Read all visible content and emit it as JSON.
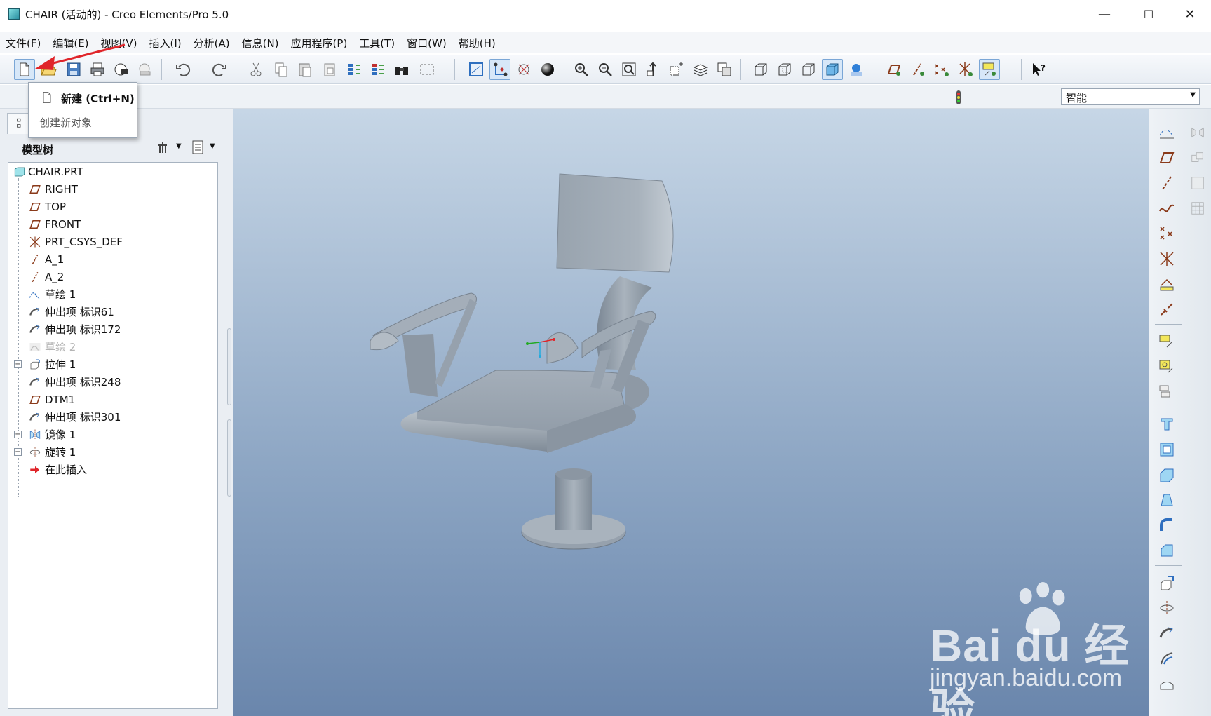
{
  "window": {
    "title": "CHAIR (活动的) - Creo Elements/Pro 5.0",
    "minimize": "—",
    "maximize": "☐",
    "close": "✕"
  },
  "menu": [
    "文件(F)",
    "编辑(E)",
    "视图(V)",
    "插入(I)",
    "分析(A)",
    "信息(N)",
    "应用程序(P)",
    "工具(T)",
    "窗口(W)",
    "帮助(H)"
  ],
  "tooltip": {
    "title": "新建 (Ctrl+N)",
    "description": "创建新对象"
  },
  "filter": {
    "value": "智能"
  },
  "panel": {
    "title": "模型树"
  },
  "tree": [
    {
      "label": "CHAIR.PRT",
      "icon": "part-icon",
      "root": true
    },
    {
      "label": "RIGHT",
      "icon": "datum-plane-icon"
    },
    {
      "label": "TOP",
      "icon": "datum-plane-icon"
    },
    {
      "label": "FRONT",
      "icon": "datum-plane-icon"
    },
    {
      "label": "PRT_CSYS_DEF",
      "icon": "csys-icon"
    },
    {
      "label": "A_1",
      "icon": "axis-icon"
    },
    {
      "label": "A_2",
      "icon": "axis-icon"
    },
    {
      "label": "草绘 1",
      "icon": "sketch-icon"
    },
    {
      "label": "伸出项 标识61",
      "icon": "sweep-icon"
    },
    {
      "label": "伸出项 标识172",
      "icon": "sweep-icon"
    },
    {
      "label": "草绘 2",
      "icon": "sketch-icon",
      "dim": true
    },
    {
      "label": "拉伸 1",
      "icon": "extrude-icon",
      "expandable": true
    },
    {
      "label": "伸出项 标识248",
      "icon": "sweep-icon"
    },
    {
      "label": "DTM1",
      "icon": "datum-plane-icon"
    },
    {
      "label": "伸出项 标识301",
      "icon": "sweep-icon"
    },
    {
      "label": "镜像 1",
      "icon": "mirror-icon",
      "expandable": true
    },
    {
      "label": "旋转 1",
      "icon": "revolve-icon",
      "expandable": true
    },
    {
      "label": "在此插入",
      "icon": "insert-here-icon"
    }
  ],
  "watermark": {
    "brand": "Bai du 经验",
    "domain": "jingyan.baidu.com"
  },
  "colors": {
    "viewport_top": "#c6d6e6",
    "viewport_bottom": "#6a86ac",
    "model_gray": "#a9b4bf",
    "arrow_red": "#e0252a"
  }
}
